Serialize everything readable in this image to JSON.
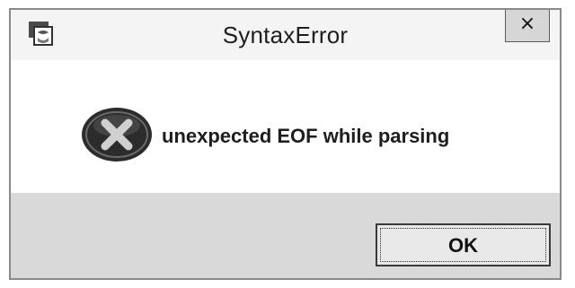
{
  "window": {
    "title": "SyntaxError",
    "app_icon": "python-app-icon",
    "close_glyph": "×",
    "close_icon": "close-icon"
  },
  "message": {
    "icon": "error-icon",
    "text": "unexpected EOF while parsing"
  },
  "buttons": {
    "ok_label": "OK"
  },
  "colors": {
    "titlebar_bg": "#f4f4f4",
    "footer_bg": "#d9d9d9",
    "close_button_bg": "#d6d6d6",
    "error_icon_bg": "#2c2c2c"
  }
}
